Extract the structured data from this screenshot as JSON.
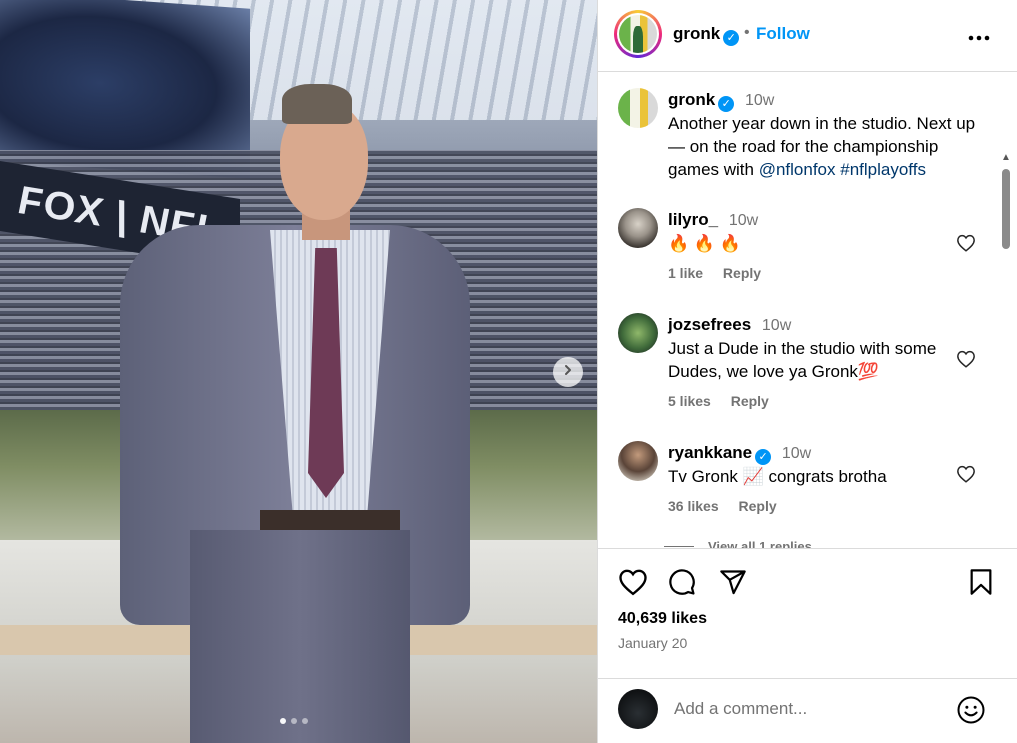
{
  "post": {
    "username": "gronk",
    "follow_label": "Follow",
    "separator": "•",
    "more_label": "•••",
    "caption_time": "10w",
    "caption_text": "Another year down in the studio. Next up — on the road for the championship games with ",
    "caption_mention": "@nflonfox",
    "caption_hashtag": "#nflplayoffs",
    "likes": "40,639 likes",
    "date": "January 20"
  },
  "media": {
    "banner_text": "FOX | NFL",
    "slide_count": 3,
    "active_slide": 1
  },
  "comments": [
    {
      "username": "lilyro_",
      "time": "10w",
      "text": "🔥 🔥 🔥",
      "likes": "1 like",
      "reply": "Reply",
      "verified": false
    },
    {
      "username": "jozsefrees",
      "time": "10w",
      "text": "Just a Dude in the studio with some Dudes, we love ya Gronk💯",
      "likes": "5 likes",
      "reply": "Reply",
      "verified": false
    },
    {
      "username": "ryankkane",
      "time": "10w",
      "text": "Tv Gronk 📈 congrats brotha",
      "likes": "36 likes",
      "reply": "Reply",
      "verified": true
    }
  ],
  "view_replies": "View all 1 replies",
  "add_comment": {
    "placeholder": "Add a comment..."
  },
  "icons": {
    "like": "heart-icon",
    "comment": "comment-icon",
    "share": "share-icon",
    "save": "bookmark-icon",
    "emoji": "emoji-icon",
    "next": "chevron-right-icon",
    "verified": "verified-badge-icon"
  },
  "colors": {
    "accent": "#0095f6",
    "link": "#00376b",
    "muted": "#737373",
    "border": "#dbdbdb"
  }
}
